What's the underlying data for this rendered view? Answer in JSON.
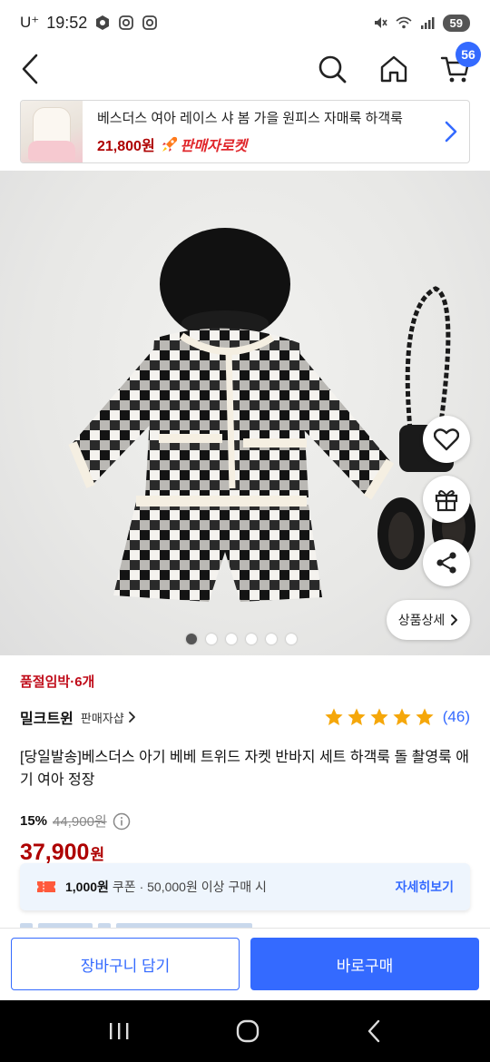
{
  "status_bar": {
    "carrier": "U⁺",
    "time": "19:52",
    "battery": "59"
  },
  "nav": {
    "cart_count": "56"
  },
  "related": {
    "title": "베스더스 여아 레이스 샤 봄 가을 원피스 자매룩 하객룩",
    "price": "21,800원",
    "badge": "판매자로켓"
  },
  "gallery": {
    "detail_button": "상품상세",
    "image_count": 6,
    "active_index": 0
  },
  "product": {
    "stock_text": "품절임박·6개",
    "seller": "밀크트윈",
    "seller_tag": "판매자샵",
    "rating": 5,
    "review_count": "(46)",
    "title": "[당일발송]베스더스 아기 베베 트위드 자켓 반바지 세트 하객룩 돌 촬영룩 애기 여아 정장",
    "discount_rate": "15%",
    "original_price": "44,900원",
    "sale_price": "37,900",
    "sale_unit": "원"
  },
  "coupon": {
    "amount": "1,000원",
    "desc": "쿠폰 · 50,000원 이상 구매 시",
    "link": "자세히보기"
  },
  "actions": {
    "add_to_cart": "장바구니 담기",
    "buy_now": "바로구매"
  },
  "colors": {
    "accent": "#346aff",
    "price_red": "#ae0000",
    "stock_red": "#c00c1a",
    "star": "#f5a70a"
  }
}
